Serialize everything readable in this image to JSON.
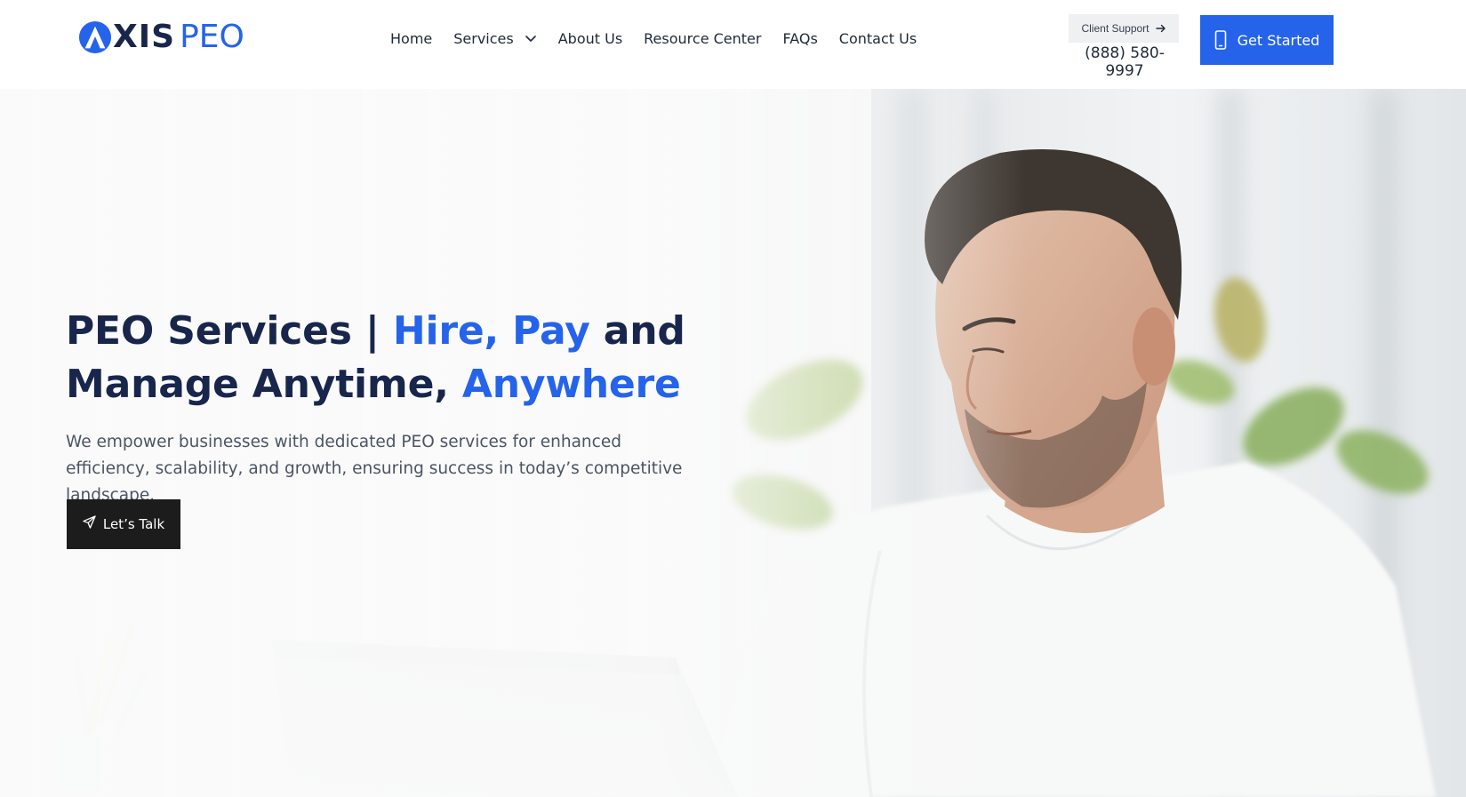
{
  "brand": {
    "logo_mark": "A",
    "logo_primary": "XIS",
    "logo_secondary": "PEO",
    "primary_color": "#18264c",
    "accent_color": "#2563eb"
  },
  "nav": {
    "items": [
      {
        "label": "Home"
      },
      {
        "label": "Services",
        "has_dropdown": true,
        "icon": "chevron-down-icon"
      },
      {
        "label": "About Us"
      },
      {
        "label": "Resource Center"
      },
      {
        "label": "FAQs"
      },
      {
        "label": "Contact Us"
      }
    ]
  },
  "header_actions": {
    "support_label": "Client Support",
    "support_icon": "arrow-right-icon",
    "phone": "(888) 580-9997",
    "get_started_label": "Get Started",
    "get_started_icon": "mobile-phone-icon",
    "get_started_color": "#2563eb"
  },
  "hero": {
    "title_part1": "PEO Services | ",
    "title_hl1": "Hire, Pay",
    "title_part2": " and Manage Anytime, ",
    "title_hl2": "Anywhere",
    "subtitle": "We empower businesses with dedicated PEO services for enhanced efficiency, scalability, and growth, ensuring success in today’s competitive landscape.",
    "cta_label": "Let’s Talk",
    "cta_icon": "paper-plane-icon",
    "cta_color": "#1c1c1c"
  }
}
